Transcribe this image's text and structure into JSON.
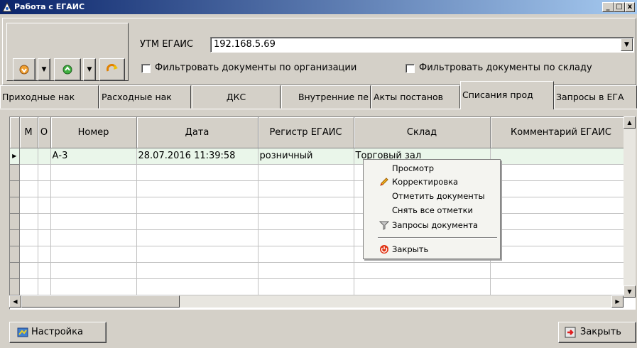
{
  "window": {
    "title": "Работа с ЕГАИС",
    "min": "_",
    "max": "□",
    "close": "x"
  },
  "toolbar": {
    "utm_label": "УТМ ЕГАИС",
    "utm_value": "192.168.5.69",
    "filter_org": "Фильтровать документы по организации",
    "filter_warehouse": "Фильтровать документы по складу"
  },
  "tabs": [
    {
      "label": "Приходные нак"
    },
    {
      "label": "Расходные нак"
    },
    {
      "label": "ДКС"
    },
    {
      "label": "Внутренние пе"
    },
    {
      "label": "Акты постанов"
    },
    {
      "label": "Списания прод"
    },
    {
      "label": "Запросы в ЕГА"
    }
  ],
  "grid": {
    "columns": [
      "М",
      "О",
      "Номер",
      "Дата",
      "Регистр ЕГАИС",
      "Склад",
      "Комментарий ЕГАИС"
    ],
    "row": {
      "number": "А-3",
      "date": "28.07.2016 11:39:58",
      "register": "розничный",
      "warehouse": "Торговый зал"
    }
  },
  "context_menu": {
    "items": [
      "Просмотр",
      "Корректировка",
      "Отметить документы",
      "Снять все отметки",
      "Запросы документа"
    ],
    "close": "Закрыть"
  },
  "footer": {
    "settings": "Настройка",
    "close": "Закрыть"
  },
  "colors": {
    "titlebar": "#0a246a",
    "face": "#d4d0c8",
    "selected_row": "#eaf6ea"
  }
}
